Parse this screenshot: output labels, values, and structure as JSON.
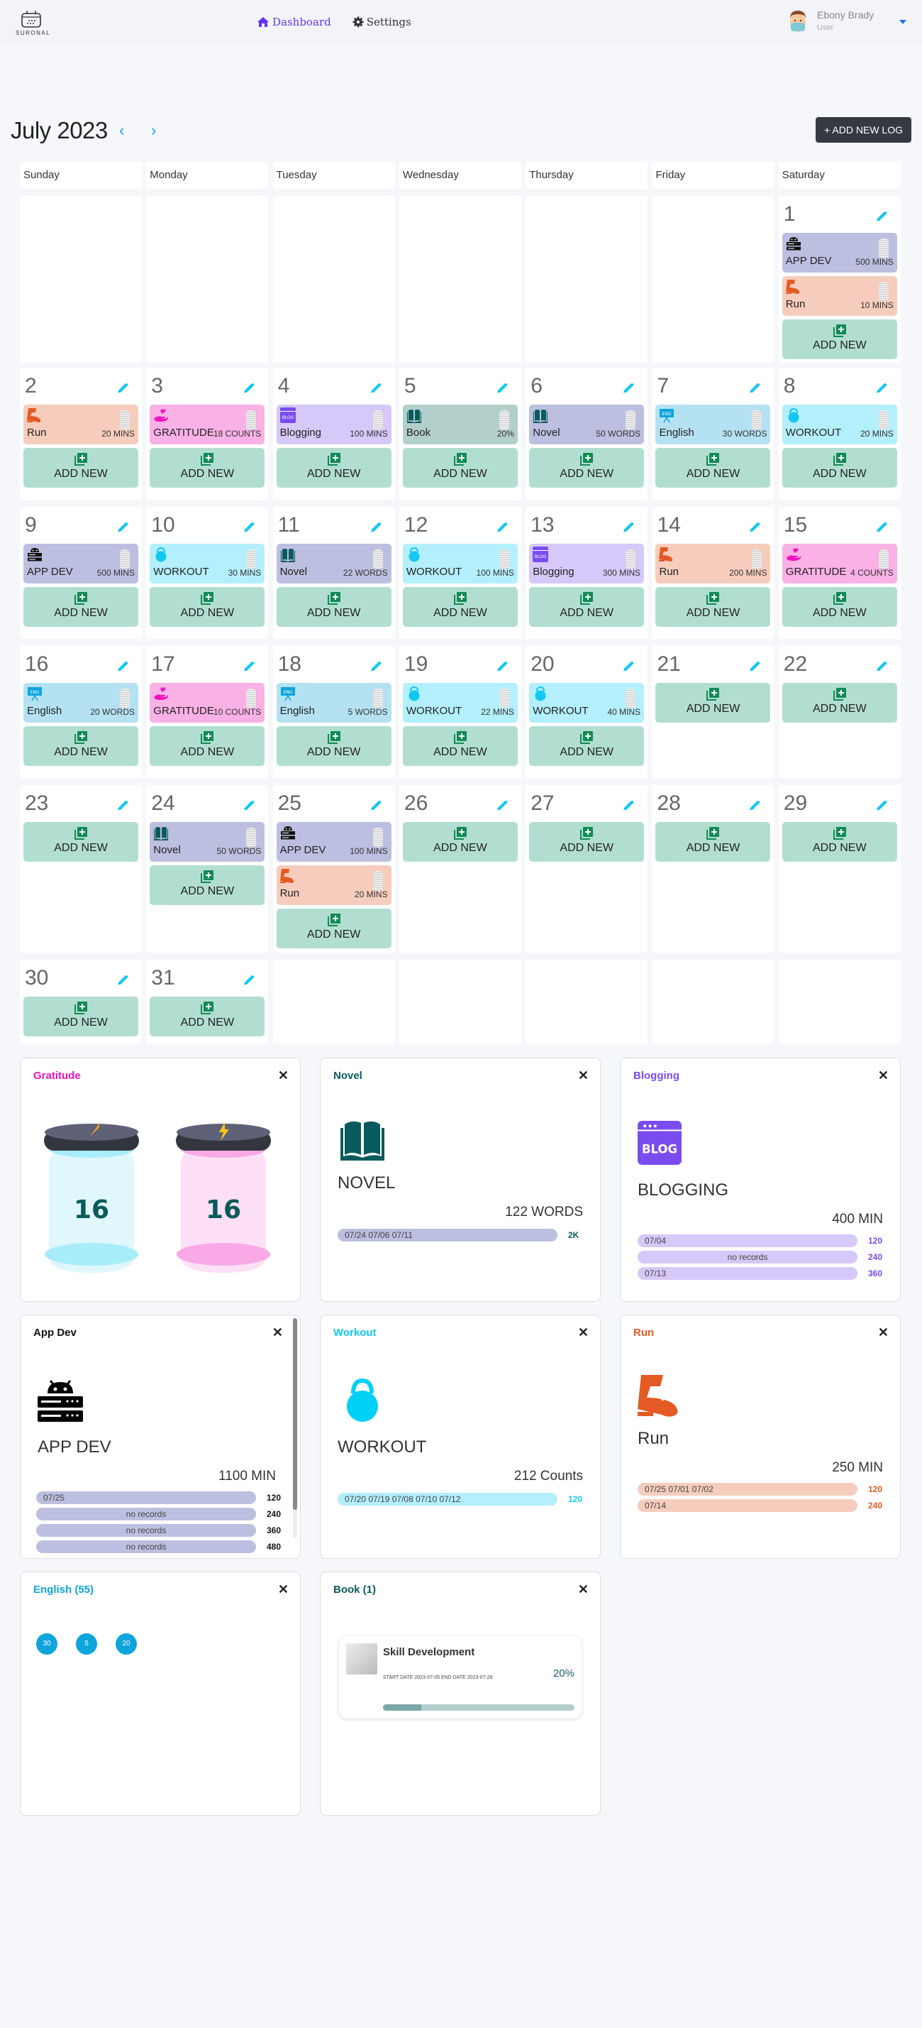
{
  "header": {
    "logo_text": "SURONAL",
    "nav": [
      {
        "label": "Dashboard",
        "icon": "home-icon",
        "active": true
      },
      {
        "label": "Settings",
        "icon": "gear-icon",
        "active": false
      }
    ],
    "user": {
      "name": "Ebony Brady",
      "role": "User"
    }
  },
  "calendar": {
    "month_label": "July 2023",
    "add_log_label": "+ ADD NEW LOG",
    "weekdays": [
      "Sunday",
      "Monday",
      "Tuesday",
      "Wednesday",
      "Thursday",
      "Friday",
      "Saturday"
    ],
    "add_new_label": "ADD NEW",
    "first_weekday_index": 6,
    "days_in_month": 31,
    "categories": {
      "appdev": {
        "bg": "#bcbfe0",
        "icon_color": "#111"
      },
      "run": {
        "bg": "#f6cdbd",
        "icon_color": "#e35a24"
      },
      "gratitude": {
        "bg": "#f9b1e6",
        "icon_color": "#f012be"
      },
      "blogging": {
        "bg": "#d6c8f8",
        "icon_color": "#7a4cf0"
      },
      "book": {
        "bg": "#b3cfcc",
        "icon_color": "#0a5b5b"
      },
      "novel": {
        "bg": "#bcbfe0",
        "icon_color": "#0a5b5b"
      },
      "english": {
        "bg": "#b5e2f3",
        "icon_color": "#0ea5dc"
      },
      "workout": {
        "bg": "#b3effc",
        "icon_color": "#12c8f2"
      }
    },
    "logs": {
      "1": [
        {
          "cat": "appdev",
          "name": "APP DEV",
          "value": "500 MINS"
        },
        {
          "cat": "run",
          "name": "Run",
          "value": "10 MINS"
        }
      ],
      "2": [
        {
          "cat": "run",
          "name": "Run",
          "value": "20 MINS"
        }
      ],
      "3": [
        {
          "cat": "gratitude",
          "name": "GRATITUDE",
          "value": "18 COUNTS"
        }
      ],
      "4": [
        {
          "cat": "blogging",
          "name": "Blogging",
          "value": "100 MINS"
        }
      ],
      "5": [
        {
          "cat": "book",
          "name": "Book",
          "value": "20%"
        }
      ],
      "6": [
        {
          "cat": "novel",
          "name": "Novel",
          "value": "50 WORDS"
        }
      ],
      "7": [
        {
          "cat": "english",
          "name": "English",
          "value": "30 WORDS"
        }
      ],
      "8": [
        {
          "cat": "workout",
          "name": "WORKOUT",
          "value": "20 MINS"
        }
      ],
      "9": [
        {
          "cat": "appdev",
          "name": "APP DEV",
          "value": "500 MINS"
        }
      ],
      "10": [
        {
          "cat": "workout",
          "name": "WORKOUT",
          "value": "30 MINS"
        }
      ],
      "11": [
        {
          "cat": "novel",
          "name": "Novel",
          "value": "22 WORDS"
        }
      ],
      "12": [
        {
          "cat": "workout",
          "name": "WORKOUT",
          "value": "100 MINS"
        }
      ],
      "13": [
        {
          "cat": "blogging",
          "name": "Blogging",
          "value": "300 MINS"
        }
      ],
      "14": [
        {
          "cat": "run",
          "name": "Run",
          "value": "200 MINS"
        }
      ],
      "15": [
        {
          "cat": "gratitude",
          "name": "GRATITUDE",
          "value": "4 COUNTS"
        }
      ],
      "16": [
        {
          "cat": "english",
          "name": "English",
          "value": "20 WORDS"
        }
      ],
      "17": [
        {
          "cat": "gratitude",
          "name": "GRATITUDE",
          "value": "10 COUNTS"
        }
      ],
      "18": [
        {
          "cat": "english",
          "name": "English",
          "value": "5 WORDS"
        }
      ],
      "19": [
        {
          "cat": "workout",
          "name": "WORKOUT",
          "value": "22 MINS"
        }
      ],
      "20": [
        {
          "cat": "workout",
          "name": "WORKOUT",
          "value": "40 MINS"
        }
      ],
      "24": [
        {
          "cat": "novel",
          "name": "Novel",
          "value": "50 WORDS"
        }
      ],
      "25": [
        {
          "cat": "appdev",
          "name": "APP DEV",
          "value": "100 MINS"
        },
        {
          "cat": "run",
          "name": "Run",
          "value": "20 MINS"
        }
      ]
    }
  },
  "widgets": {
    "gratitude": {
      "title": "Gratitude",
      "color": "#f012be",
      "jar_counts": [
        "16",
        "16"
      ]
    },
    "novel": {
      "title": "Novel",
      "color": "#0a5b5b",
      "name": "NOVEL",
      "total": "122 WORDS",
      "bars": [
        {
          "label": "07/24 07/06 07/11",
          "value": "2K"
        }
      ],
      "bar_bg": "#bcbfe0"
    },
    "blogging": {
      "title": "Blogging",
      "color": "#7a4cf0",
      "name": "BLOGGING",
      "total": "400 MIN",
      "bars": [
        {
          "label": "07/04",
          "value": "120"
        },
        {
          "label": "no records",
          "value": "240",
          "center": true
        },
        {
          "label": "07/13",
          "value": "360"
        }
      ],
      "bar_bg": "#d6c8f8"
    },
    "appdev": {
      "title": "App Dev",
      "color": "#111111",
      "name": "APP DEV",
      "total": "1100 MIN",
      "bars": [
        {
          "label": "07/25",
          "value": "120"
        },
        {
          "label": "no records",
          "value": "240",
          "center": true
        },
        {
          "label": "no records",
          "value": "360",
          "center": true
        },
        {
          "label": "no records",
          "value": "480",
          "center": true
        }
      ],
      "bar_bg": "#bcbfe0"
    },
    "workout": {
      "title": "Workout",
      "color": "#12c8f2",
      "name": "WORKOUT",
      "total": "212 Counts",
      "bars": [
        {
          "label": "07/20 07/19 07/08 07/10 07/12",
          "value": "120"
        }
      ],
      "bar_bg": "#b3effc"
    },
    "run": {
      "title": "Run",
      "color": "#e35a24",
      "name": "Run",
      "total": "250 MIN",
      "bars": [
        {
          "label": "07/25 07/01 07/02",
          "value": "120"
        },
        {
          "label": "07/14",
          "value": "240"
        }
      ],
      "bar_bg": "#f6cdbd"
    },
    "english": {
      "title": "English (55)",
      "color": "#0ea5dc",
      "circles": [
        "30",
        "5",
        "20"
      ]
    },
    "book": {
      "title": "Book (1)",
      "color": "#0a5b5b",
      "item": {
        "title": "Skill Development",
        "dates": "START DATE 2023-07-05   END DATE 2023-07-28",
        "percent_label": "20%",
        "progress": 0.2
      }
    }
  }
}
